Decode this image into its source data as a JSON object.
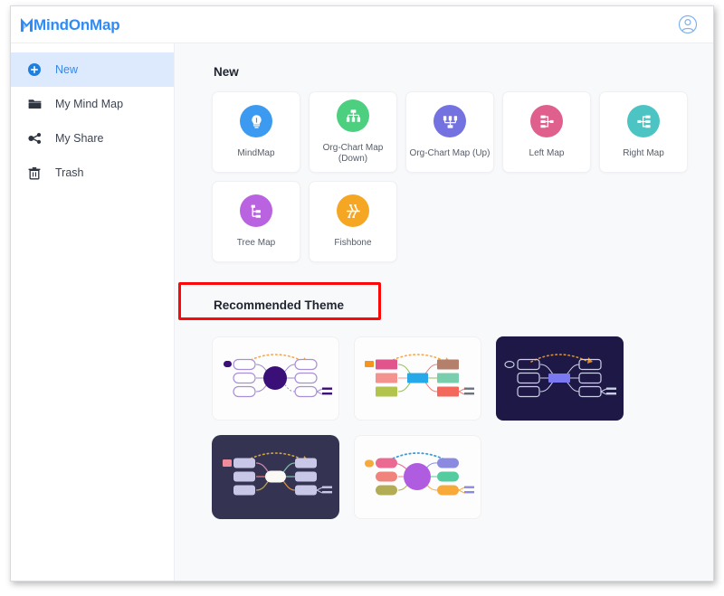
{
  "app": {
    "logo_text": "MindOnMap",
    "logo_accent": "#2f8bf5",
    "avatar_icon": "user-circle-icon"
  },
  "sidebar": {
    "items": [
      {
        "label": "New",
        "icon": "plus-circle-icon",
        "active": true
      },
      {
        "label": "My Mind Map",
        "icon": "folder-icon",
        "active": false
      },
      {
        "label": "My Share",
        "icon": "share-nodes-icon",
        "active": false
      },
      {
        "label": "Trash",
        "icon": "trash-icon",
        "active": false
      }
    ]
  },
  "main": {
    "new_section_title": "New",
    "types": [
      {
        "label": "MindMap",
        "icon": "lightbulb-icon",
        "color": "#3c9bf0"
      },
      {
        "label": "Org-Chart Map (Down)",
        "icon": "org-chart-down-icon",
        "color": "#4ccf7e"
      },
      {
        "label": "Org-Chart Map (Up)",
        "icon": "org-chart-up-icon",
        "color": "#7472e0"
      },
      {
        "label": "Left Map",
        "icon": "left-map-icon",
        "color": "#e0608d"
      },
      {
        "label": "Right Map",
        "icon": "right-map-icon",
        "color": "#4cc4c4"
      },
      {
        "label": "Tree Map",
        "icon": "tree-map-icon",
        "color": "#ba63e0"
      },
      {
        "label": "Fishbone",
        "icon": "fishbone-icon",
        "color": "#f5a623"
      }
    ],
    "theme_section_title": "Recommended Theme",
    "highlight_color": "#fb0808",
    "themes": [
      {
        "name": "purple-outline-light",
        "background": "#ffffff",
        "center_shape": "circle",
        "center_color": "#3b0f78",
        "node_style": "outline",
        "node_color": "#b9a5de",
        "arrow_color": "#f7a64a",
        "accent_color": "#3b0f78"
      },
      {
        "name": "colorful-rect-light",
        "background": "#ffffff",
        "center_shape": "rect",
        "center_color": "#27a8e8",
        "node_style": "filled",
        "node_colors": [
          "#e0558c",
          "#f4938d",
          "#b2c44b",
          "#b4806c",
          "#79cfad",
          "#f4685c"
        ],
        "arrow_color": "#f7a64a",
        "accent_color": "#f7941e"
      },
      {
        "name": "dark-navy-outline",
        "background": "#1d1846",
        "center_shape": "rect",
        "center_color": "#7b79f2",
        "node_style": "outline",
        "node_color": "#cdd0e8",
        "arrow_color": "#d98f2e",
        "accent_color": "#cdd0e8"
      },
      {
        "name": "dark-slate-lavender",
        "background": "#343351",
        "center_shape": "oval",
        "center_color": "#fbf9f4",
        "node_style": "filled",
        "node_color": "#c8c7e8",
        "arrow_color": "#d6a53f",
        "accent_color": "#f08b9b"
      },
      {
        "name": "purple-circle-colorful",
        "background": "#ffffff",
        "center_shape": "circle",
        "center_color": "#b05ce0",
        "node_style": "filled",
        "node_colors": [
          "#ea6a91",
          "#f0837c",
          "#b2ac54",
          "#8c8ae0",
          "#55ccA0",
          "#f7a93a"
        ],
        "arrow_color": "#3d9ddb",
        "accent_color": "#f7a93a"
      }
    ]
  }
}
